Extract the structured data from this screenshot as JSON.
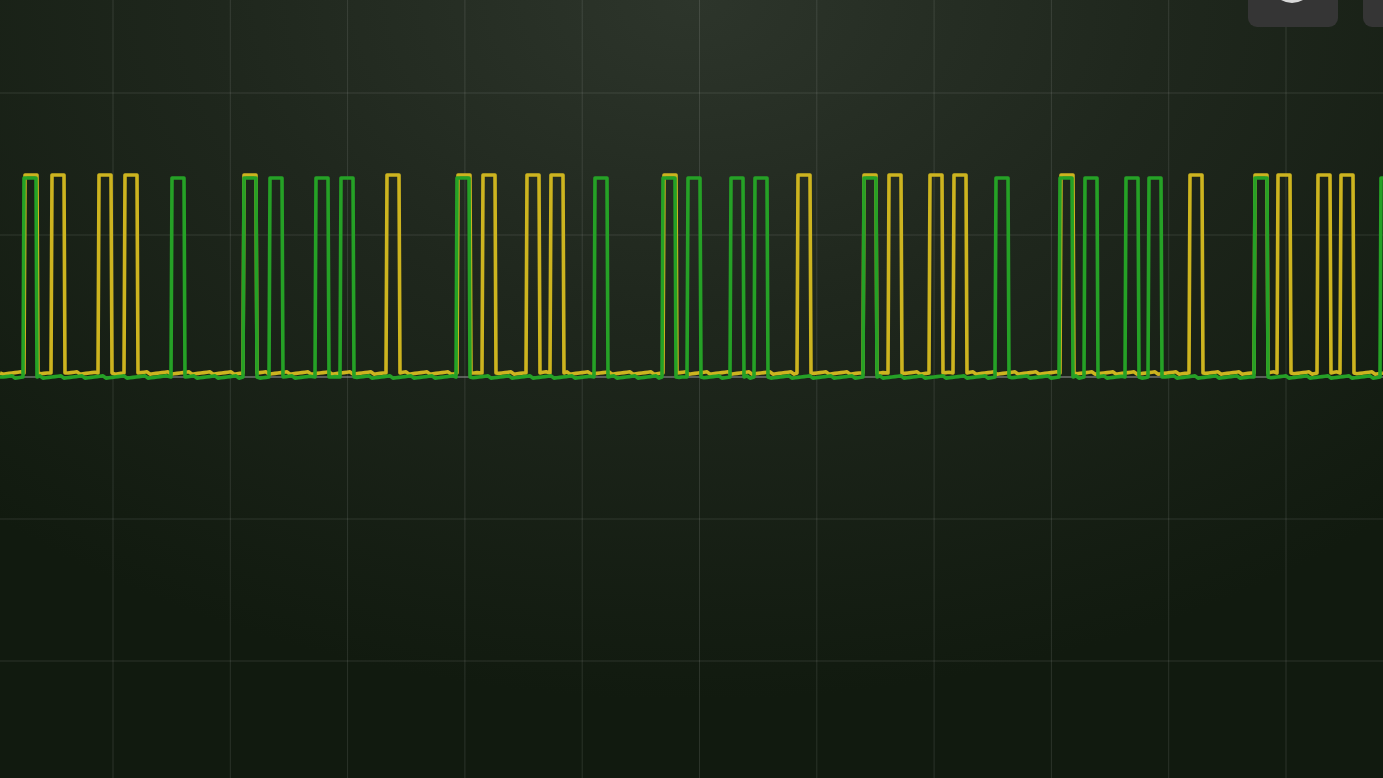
{
  "display": {
    "traces": [
      {
        "color": "#cdb41f"
      },
      {
        "color": "#25a126"
      }
    ]
  }
}
